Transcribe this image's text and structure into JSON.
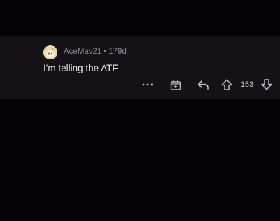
{
  "comment": {
    "author": "AceMav21",
    "separator": "•",
    "age": "179d",
    "text": "I'm telling the ATF",
    "score": "153"
  },
  "icons": {
    "more": "more-horizontal-icon",
    "award": "award-gift-icon",
    "reply": "reply-arrow-icon",
    "upvote": "upvote-arrow-icon",
    "downvote": "downvote-arrow-icon"
  },
  "colors": {
    "background": "#050307",
    "card": "#141217",
    "text": "#e6e4e8",
    "meta": "#8a8790",
    "icon": "#bdbac2",
    "avatar": "#e7d6a0"
  }
}
